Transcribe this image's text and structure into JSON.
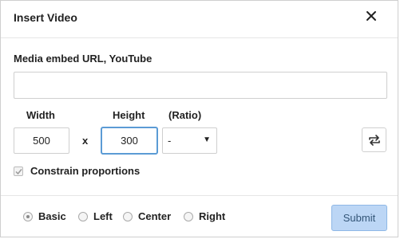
{
  "dialog": {
    "title": "Insert Video",
    "close_icon": "close-icon"
  },
  "url": {
    "label": "Media embed URL, YouTube",
    "value": "",
    "placeholder": ""
  },
  "dimensions": {
    "width_label": "Width",
    "height_label": "Height",
    "ratio_label": "(Ratio)",
    "width_value": "500",
    "height_value": "300",
    "separator": "x",
    "ratio_selected": "-",
    "ratio_icon": "swap-icon"
  },
  "constrain": {
    "label": "Constrain proportions",
    "checked": true
  },
  "alignment": {
    "options": [
      "Basic",
      "Left",
      "Center",
      "Right"
    ],
    "selected": "Basic"
  },
  "submit_label": "Submit",
  "colors": {
    "submit_bg": "#bcd6f5",
    "focus_border": "#5b9bd5"
  }
}
